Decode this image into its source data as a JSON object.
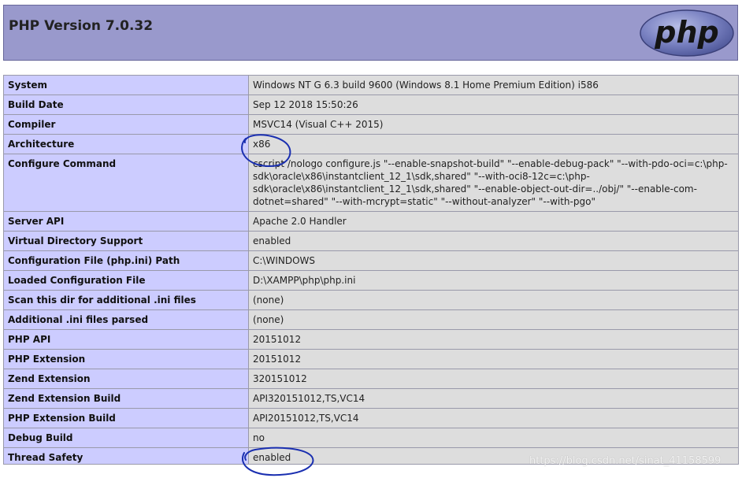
{
  "header": {
    "title": "PHP Version 7.0.32",
    "logo_text": "php"
  },
  "rows": [
    {
      "key": "System",
      "value": "Windows NT G 6.3 build 9600 (Windows 8.1 Home Premium Edition) i586"
    },
    {
      "key": "Build Date",
      "value": "Sep 12 2018 15:50:26"
    },
    {
      "key": "Compiler",
      "value": "MSVC14 (Visual C++ 2015)"
    },
    {
      "key": "Architecture",
      "value": "x86"
    },
    {
      "key": "Configure Command",
      "value": "cscript /nologo configure.js \"--enable-snapshot-build\" \"--enable-debug-pack\" \"--with-pdo-oci=c:\\php-sdk\\oracle\\x86\\instantclient_12_1\\sdk,shared\" \"--with-oci8-12c=c:\\php-sdk\\oracle\\x86\\instantclient_12_1\\sdk,shared\" \"--enable-object-out-dir=../obj/\" \"--enable-com-dotnet=shared\" \"--with-mcrypt=static\" \"--without-analyzer\" \"--with-pgo\""
    },
    {
      "key": "Server API",
      "value": "Apache 2.0 Handler"
    },
    {
      "key": "Virtual Directory Support",
      "value": "enabled"
    },
    {
      "key": "Configuration File (php.ini) Path",
      "value": "C:\\WINDOWS"
    },
    {
      "key": "Loaded Configuration File",
      "value": "D:\\XAMPP\\php\\php.ini"
    },
    {
      "key": "Scan this dir for additional .ini files",
      "value": "(none)"
    },
    {
      "key": "Additional .ini files parsed",
      "value": "(none)"
    },
    {
      "key": "PHP API",
      "value": "20151012"
    },
    {
      "key": "PHP Extension",
      "value": "20151012"
    },
    {
      "key": "Zend Extension",
      "value": "320151012"
    },
    {
      "key": "Zend Extension Build",
      "value": "API320151012,TS,VC14"
    },
    {
      "key": "PHP Extension Build",
      "value": "API20151012,TS,VC14"
    },
    {
      "key": "Debug Build",
      "value": "no"
    },
    {
      "key": "Thread Safety",
      "value": "enabled"
    }
  ],
  "watermark": "https://blog.csdn.net/sinat_41158599",
  "colors": {
    "header_bg": "#9999cc",
    "key_bg": "#ccccff",
    "value_bg": "#dddddd",
    "annotation": "#1a2fb0"
  }
}
